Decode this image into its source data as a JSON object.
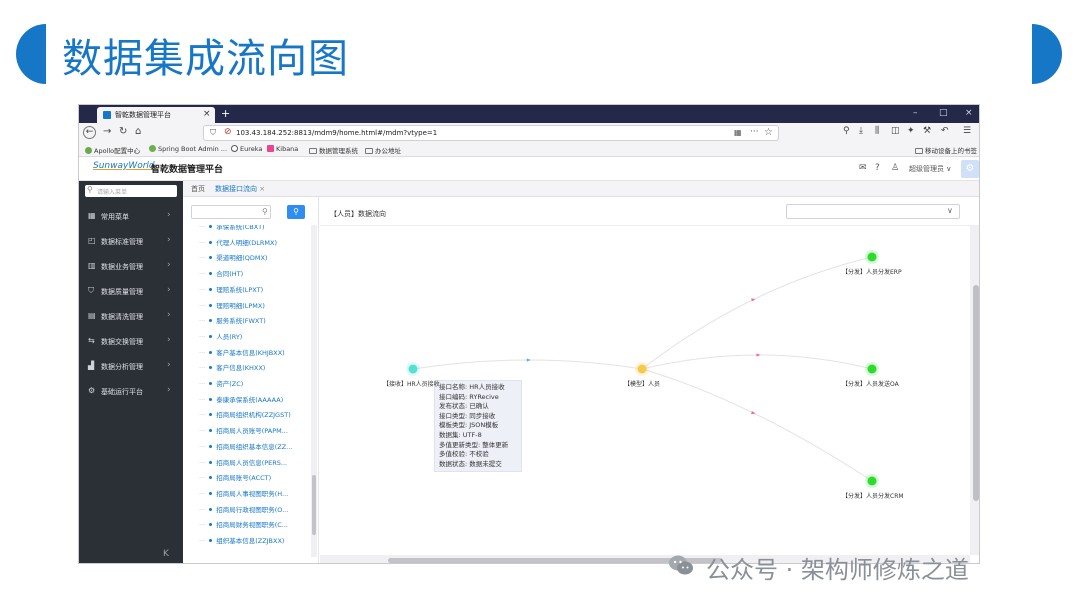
{
  "slide": {
    "title": "数据集成流向图",
    "accent_color": "#1677c7"
  },
  "browser": {
    "tab_title": "智乾数据管理平台",
    "tab_close": "×",
    "new_tab": "+",
    "window_controls": [
      "–",
      "□",
      "×"
    ],
    "url": "103.43.184.252:8813/mdm9/home.html#/mdm?vtype=1",
    "url_more": "···",
    "bookmarks": [
      {
        "label": "Apollo配置中心",
        "icon": "apollo-icon",
        "color": "#6aa84f"
      },
      {
        "label": "Spring Boot Admin ...",
        "icon": "spring-icon",
        "color": "#6ab04c"
      },
      {
        "label": "Eureka",
        "icon": "globe-icon",
        "color": "#555555"
      },
      {
        "label": "Kibana",
        "icon": "kibana-icon",
        "color": "#e8488b"
      },
      {
        "label": "数据管理系统",
        "icon": "folder-icon"
      },
      {
        "label": "办公地址",
        "icon": "folder-icon"
      }
    ],
    "mobile_bookmarks": "移动设备上的书签"
  },
  "app": {
    "logo": "SunwayWorld",
    "name": "智乾数据管理平台",
    "user": "超级管理员",
    "search_placeholder": "请输入菜单",
    "menu": [
      {
        "label": "常用菜单",
        "icon": "grid-icon"
      },
      {
        "label": "数据标准管理",
        "icon": "standard-icon"
      },
      {
        "label": "数据业务管理",
        "icon": "business-icon"
      },
      {
        "label": "数据质量管理",
        "icon": "quality-icon"
      },
      {
        "label": "数据清洗管理",
        "icon": "clean-icon"
      },
      {
        "label": "数据交换管理",
        "icon": "exchange-icon"
      },
      {
        "label": "数据分析管理",
        "icon": "analysis-icon"
      },
      {
        "label": "基础运行平台",
        "icon": "platform-icon"
      }
    ],
    "page_tabs": {
      "home": "首页",
      "active": "数据接口流向",
      "close": "×"
    }
  },
  "tree": {
    "items": [
      "承保系统(CBXT)",
      "代理人明细(DLRMX)",
      "渠道明细(QDMX)",
      "合同(HT)",
      "理赔系统(LPXT)",
      "理赔明细(LPMX)",
      "服务系统(FWXT)",
      "人员(RY)",
      "客户基本信息(KHJBXX)",
      "客户信息(KHXX)",
      "资产(ZC)",
      "泰康承保系统(AAAAA)",
      "招商局组织机构(ZZJGST)",
      "招商局人员账号(PAPM...",
      "招商局组织基本信息(ZZ...",
      "招商局人员信息(PERS...",
      "招商局账号(ACCT)",
      "招商局人事视图职务(H...",
      "招商局行政视图职务(O...",
      "招商局财务视图职务(C...",
      "组织基本信息(ZZJBXX)"
    ]
  },
  "graph": {
    "header": "【人员】数据流向",
    "nodes": [
      {
        "id": "recv",
        "label": "【接收】HR人员接收",
        "color": "#55e0d2"
      },
      {
        "id": "model",
        "label": "【模型】人员",
        "color": "#f7c948"
      },
      {
        "id": "erp",
        "label": "【分发】人员分发ERP",
        "color": "#2bdc2b"
      },
      {
        "id": "oa",
        "label": "【分发】人员发送OA",
        "color": "#2bdc2b"
      },
      {
        "id": "crm",
        "label": "【分发】人员分发CRM",
        "color": "#2bdc2b"
      }
    ],
    "edges": [
      {
        "from": "recv",
        "to": "model"
      },
      {
        "from": "model",
        "to": "erp"
      },
      {
        "from": "model",
        "to": "oa"
      },
      {
        "from": "model",
        "to": "crm"
      }
    ],
    "tooltip": [
      "接口名称: HR人员接收",
      "接口编码: RYRecive",
      "发布状态: 已确认",
      "接口类型: 同步接收",
      "模板类型: JSON模板",
      "数据集: UTF-8",
      "多值更新类型: 整体更新",
      "多值校验: 不校验",
      "数据状态: 数据未提交"
    ]
  },
  "watermark": "公众号 · 架构师修炼之道"
}
